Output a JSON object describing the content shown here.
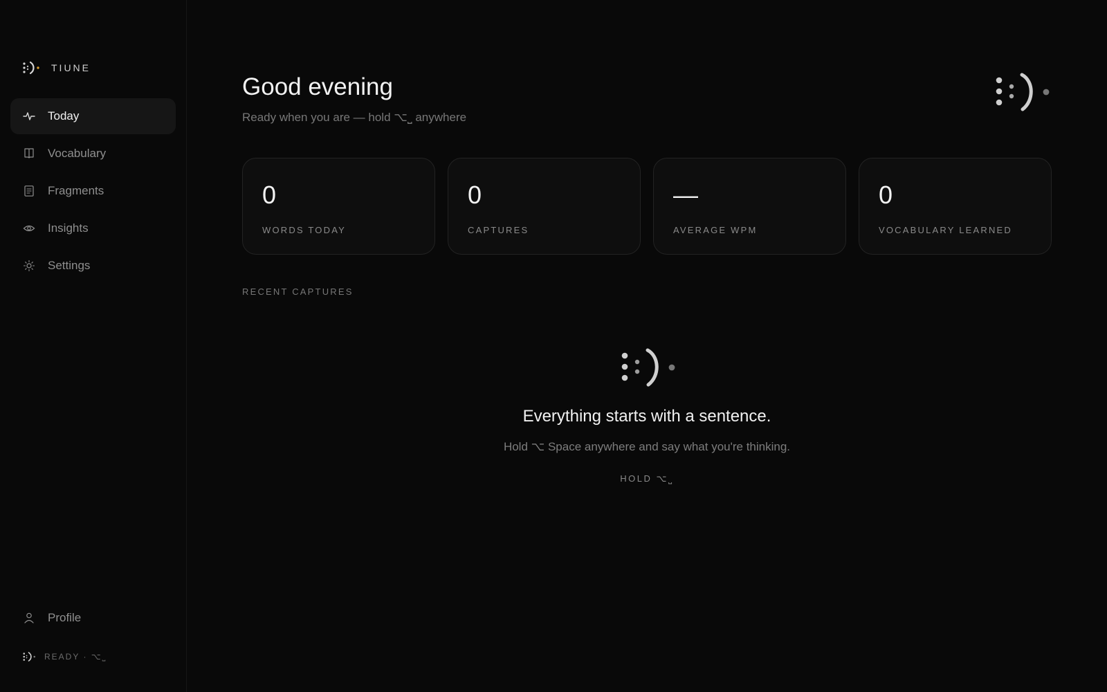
{
  "sidebar": {
    "brand": "TIUNE",
    "brand_icon": "tiune-logo-icon",
    "items": [
      {
        "label": "Today",
        "icon": "pulse-icon",
        "active": true
      },
      {
        "label": "Vocabulary",
        "icon": "book-icon",
        "active": false
      },
      {
        "label": "Fragments",
        "icon": "document-icon",
        "active": false
      },
      {
        "label": "Insights",
        "icon": "eye-icon",
        "active": false
      },
      {
        "label": "Settings",
        "icon": "sun-gear-icon",
        "active": false
      }
    ],
    "profile": {
      "label": "Profile",
      "icon": "user-icon"
    },
    "status": "READY · ⌥⎵"
  },
  "header": {
    "greeting": "Good evening",
    "subtitle": "Ready when you are — hold ⌥⎵ anywhere"
  },
  "stats": [
    {
      "value": "0",
      "label": "WORDS TODAY"
    },
    {
      "value": "0",
      "label": "CAPTURES"
    },
    {
      "value": "—",
      "label": "AVERAGE WPM"
    },
    {
      "value": "0",
      "label": "VOCABULARY LEARNED"
    }
  ],
  "recent": {
    "label": "RECENT CAPTURES",
    "empty_title": "Everything starts with a sentence.",
    "empty_text": "Hold ⌥ Space anywhere and say what you're thinking.",
    "hint": "HOLD ⌥⎵"
  },
  "colors": {
    "background": "#090909",
    "active_nav": "#161616",
    "card_border": "#232323",
    "logo_accent": "#d59a2f"
  }
}
